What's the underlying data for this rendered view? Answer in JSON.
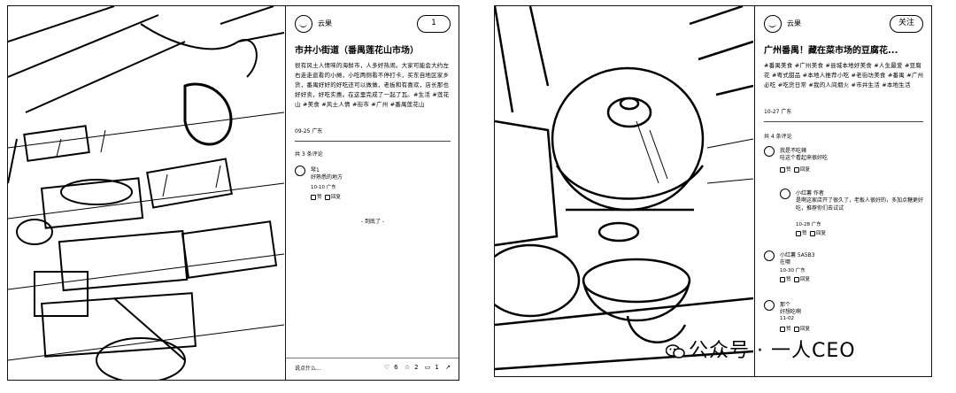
{
  "left": {
    "author": "云果",
    "follow_label": "1",
    "title": "市井小街道（番禺莲花山市场）",
    "body": "很有风土人情味的海鲜市，人多好热闹。大家可能会大约左右走走逛看的小摊，小吃两侧看不停打卡，买东自地区家乡货，番禺好好的好吃还可以做做，老板和有喜欢，店长那也好好卖，好吃实惠。在这里完成了一起了瓦。#生活 #莲花山 #美食 #风土人情 #街市 #广州 #番禺莲花山",
    "date": "09-25 广东",
    "comment_count": "共 3 条评论",
    "comment": {
      "name": "琴1",
      "text": "好熟悉的地方",
      "meta": "10-10 广东",
      "like": "赞",
      "reply": "回复"
    },
    "more": "- 到底了 -",
    "bar": {
      "input": "说点什么...",
      "likes": "6",
      "stars": "2",
      "comments": "1"
    }
  },
  "right": {
    "author": "云果",
    "follow_label": "关注",
    "title": "广州番禺！藏在菜市场的豆腐花...",
    "body": "#番禺美食 #广州美食 #县城本地好美食 #人生最爱 #豆腐花 #粤式甜品 #本地人推荐小吃 #老街坊美食 #番禺 #广州必吃 #吃货日常 #我的人间烟火 #市井生活 #本地生活",
    "date": "10-27 广东",
    "comment_count": "共 4 条评论",
    "comments": [
      {
        "name": "我是不吃辣",
        "text": "哇这个看起来很好吃",
        "meta": "",
        "like": "赞",
        "reply": "回复"
      },
      {
        "name": "小红薯 作者",
        "text": "是啊这家店开了很久了，老板人很好的，多加点糖更好吃，推荐你们去试试",
        "meta": "10-28 广东",
        "like": "赞",
        "reply": "回复"
      },
      {
        "name": "小红薯 5A5B3",
        "text": "在哪",
        "meta": "10-30 广东",
        "like": "赞",
        "reply": "回复"
      },
      {
        "name": "那个",
        "text": "好想吃啊",
        "meta": "11-02",
        "like": "赞",
        "reply": "回复"
      }
    ]
  },
  "watermark": "公众号 · 一人CEO"
}
